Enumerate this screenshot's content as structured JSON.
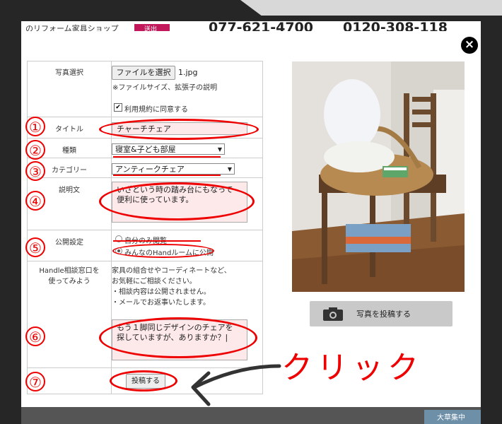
{
  "background": {
    "site_text": "のリフォーム家具ショップ",
    "badge": "送出",
    "phone1": "077-621-4700",
    "phone2": "0120-308-118",
    "bottom_badge": "大草集中"
  },
  "form": {
    "photo_label": "写真選択",
    "file_button": "ファイルを選択",
    "file_name": "1.jpg",
    "file_note": "※ファイルサイズ、拡張子の説明",
    "agree_label": "利用規約に同意する",
    "agree_checked": true,
    "title_label": "タイトル",
    "title_value": "チャーチチェア",
    "type_label": "種類",
    "type_value": "寝室&子ども部屋",
    "category_label": "カテゴリー",
    "category_value": "アンティークチェア",
    "desc_label": "説明文",
    "desc_line1": "いざという時の踏み台にもなって",
    "desc_line2": "便利に使っています。",
    "visibility_label": "公開設定",
    "visibility_options": [
      "自分のみ閲覧",
      "みんなのHandルームに公開"
    ],
    "visibility_selected": 1,
    "handle_label_line1": "Handle相談窓口を",
    "handle_label_line2": "使ってみよう",
    "help_lines": [
      "家具の組合せやコーディネートなど、",
      "お気軽にご相談ください。",
      "・相談内容は公開されません。",
      "・メールでお返事いたします。"
    ],
    "consult_line1": "もう１脚同じデザインのチェアを",
    "consult_line2": "探していますが、ありますか？|",
    "submit_label": "投稿する"
  },
  "upload": {
    "label": "写真を投稿する",
    "icon": "camera-icon"
  },
  "close": {
    "label": "×",
    "icon": "close-icon"
  },
  "annotations": {
    "numbers": [
      "①",
      "②",
      "③",
      "④",
      "⑤",
      "⑥",
      "⑦"
    ],
    "click_text": "クリック",
    "color": "#e00000"
  }
}
